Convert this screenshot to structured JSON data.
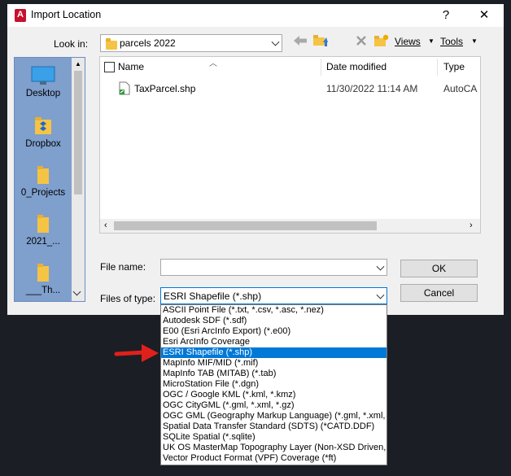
{
  "window": {
    "title": "Import Location",
    "app_icon_letter": "A",
    "help_glyph": "?",
    "close_glyph": "✕"
  },
  "toolbar": {
    "look_in_label": "Look in:",
    "look_in_value": "parcels 2022",
    "views_label": "Views",
    "tools_label": "Tools"
  },
  "places": [
    {
      "label": "Desktop",
      "icon": "desktop-icon"
    },
    {
      "label": "Dropbox",
      "icon": "dropbox-icon"
    },
    {
      "label": "0_Projects",
      "icon": "folder-icon"
    },
    {
      "label": "2021_...",
      "icon": "folder-icon"
    },
    {
      "label": "___Th...",
      "icon": "folder-icon"
    }
  ],
  "file_list": {
    "columns": {
      "name": "Name",
      "date": "Date modified",
      "type": "Type"
    },
    "rows": [
      {
        "name": "TaxParcel.shp",
        "date": "11/30/2022 11:14 AM",
        "type": "AutoCA"
      }
    ]
  },
  "form": {
    "file_name_label": "File name:",
    "file_name_value": "",
    "files_of_type_label": "Files of type:",
    "files_of_type_value": "ESRI Shapefile  (*.shp)",
    "ok_label": "OK",
    "cancel_label": "Cancel"
  },
  "type_options": [
    "ASCII Point File  (*.txt, *.csv, *.asc, *.nez)",
    "Autodesk SDF  (*.sdf)",
    "E00 (Esri ArcInfo Export) (*.e00)",
    "Esri ArcInfo Coverage",
    "ESRI Shapefile  (*.shp)",
    "MapInfo MIF/MID (*.mif)",
    "MapInfo TAB (MITAB) (*.tab)",
    "MicroStation File  (*.dgn)",
    "OGC / Google KML  (*.kml, *.kmz)",
    "OGC CityGML (*.gml, *.xml, *.gz)",
    "OGC GML (Geography Markup Language) (*.gml, *.xml, *.g",
    "Spatial Data Transfer Standard (SDTS) (*CATD.DDF)",
    "SQLite Spatial  (*.sqlite)",
    "UK OS MasterMap Topography Layer (Non-XSD Driven, G",
    "Vector Product Format (VPF) Coverage (*ft)"
  ],
  "selected_option_index": 4,
  "colors": {
    "selection": "#0078d7",
    "places_bg": "#7f9fcd",
    "annotation_arrow": "#e0201b"
  }
}
